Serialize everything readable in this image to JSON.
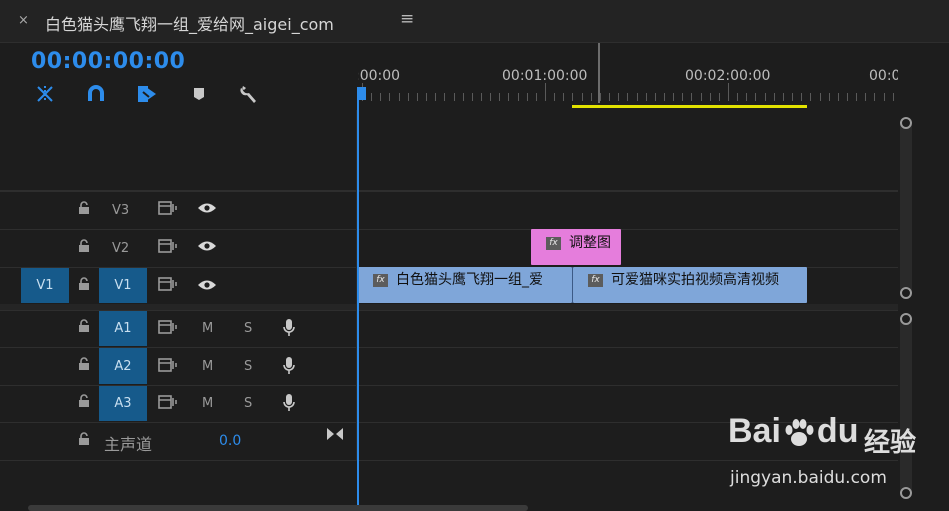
{
  "tab": {
    "close_glyph": "×",
    "title": "白色猫头鹰飞翔一组_爱给网_aigei_com",
    "menu_glyph": "≡"
  },
  "timecode": "00:00:00:00",
  "tools": [
    "snap-icon",
    "magnet-icon",
    "linked-selection-icon",
    "marker-icon",
    "wrench-icon"
  ],
  "ruler": {
    "labels": [
      ":00:00",
      "00:01:00:00",
      "00:02:00:00",
      "00:0"
    ]
  },
  "tracks": {
    "video": [
      {
        "source": "",
        "name": "V3",
        "selected": false
      },
      {
        "source": "",
        "name": "V2",
        "selected": false
      },
      {
        "source": "V1",
        "name": "V1",
        "selected": true
      }
    ],
    "audio": [
      {
        "name": "A1",
        "m": "M",
        "s": "S"
      },
      {
        "name": "A2",
        "m": "M",
        "s": "S"
      },
      {
        "name": "A3",
        "m": "M",
        "s": "S"
      }
    ],
    "master": {
      "label": "主声道",
      "value": "0.0"
    }
  },
  "clips": [
    {
      "label": "调整图",
      "fx": "fx",
      "color": "#e57ddc"
    },
    {
      "label": "白色猫头鹰飞翔一组_爱",
      "fx": "fx",
      "color": "#7fa6d9"
    },
    {
      "label": "可爱猫咪实拍视频高清视频",
      "fx": "fx",
      "color": "#7fa6d9"
    }
  ],
  "watermark": {
    "brand": "Bai",
    "brand2": "du",
    "cn": "经验",
    "url": "jingyan.baidu.com"
  },
  "colors": {
    "accent": "#2d8ceb",
    "workarea": "#e2e200",
    "adjustment_clip": "#e57ddc",
    "video_clip": "#7fa6d9"
  }
}
